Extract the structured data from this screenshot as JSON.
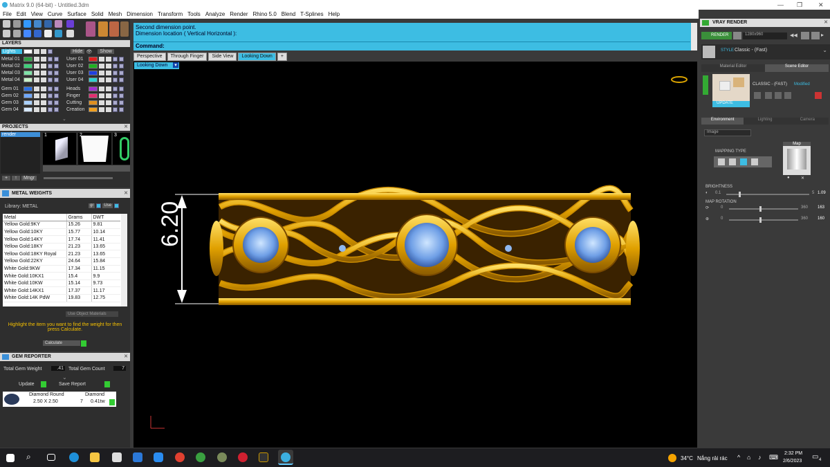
{
  "window": {
    "title": "Matrix 9.0 (64-bit) - Untitled.3dm"
  },
  "menu": [
    "File",
    "Edit",
    "View",
    "Curve",
    "Surface",
    "Solid",
    "Mesh",
    "Dimension",
    "Transform",
    "Tools",
    "Analyze",
    "Render",
    "Rhino 5.0",
    "Blend",
    "T-Splines",
    "Help"
  ],
  "layers": {
    "title": "LAYERS",
    "selected": "Lights",
    "hide": "Hide",
    "show": "Show",
    "left": [
      {
        "name": "Metal 01",
        "color": "#2ea043"
      },
      {
        "name": "Metal 02",
        "color": "#3fd07a"
      },
      {
        "name": "Metal 03",
        "color": "#7fe2a6"
      },
      {
        "name": "Metal 04",
        "color": "#c8f0c8"
      },
      {
        "name": "Gem 01",
        "color": "#2a6fe0"
      },
      {
        "name": "Gem 02",
        "color": "#6fa8ff"
      },
      {
        "name": "Gem 03",
        "color": "#a9d0ff"
      },
      {
        "name": "Gem 04",
        "color": "#d6e8ff"
      }
    ],
    "right": [
      {
        "name": "User 01",
        "color": "#e02020"
      },
      {
        "name": "User 02",
        "color": "#20b020"
      },
      {
        "name": "User 03",
        "color": "#2040e0"
      },
      {
        "name": "User 04",
        "color": "#30d0d0"
      },
      {
        "name": "Heads",
        "color": "#a030d0"
      },
      {
        "name": "Finger",
        "color": "#e03070"
      },
      {
        "name": "Cutting",
        "color": "#e09020"
      },
      {
        "name": "Creation",
        "color": "#f0a020"
      }
    ]
  },
  "projects": {
    "title": "PROJECTS",
    "item": "render",
    "thumbs": [
      "1",
      "2",
      "3"
    ],
    "mngr": "Mngr"
  },
  "metal_weights": {
    "title": "METAL WEIGHTS",
    "library": "Library: METAL",
    "unit1": "gr",
    "unit2": "Use",
    "headers": [
      "Metal",
      "Grams",
      "DWT"
    ],
    "rows": [
      [
        "Yellow Gold:9KY",
        "15.26",
        "9.81"
      ],
      [
        "Yellow Gold:10KY",
        "15.77",
        "10.14"
      ],
      [
        "Yellow Gold:14KY",
        "17.74",
        "11.41"
      ],
      [
        "Yellow Gold:18KY",
        "21.23",
        "13.65"
      ],
      [
        "Yellow Gold:18KY Royal",
        "21.23",
        "13.65"
      ],
      [
        "Yellow Gold:22KY",
        "24.64",
        "15.84"
      ],
      [
        "White Gold:9KW",
        "17.34",
        "11.15"
      ],
      [
        "White Gold:10KX1",
        "15.4",
        "9.9"
      ],
      [
        "White Gold:10KW",
        "15.14",
        "9.73"
      ],
      [
        "White Gold:14KX1",
        "17.37",
        "11.17"
      ],
      [
        "White Gold:14K PdW",
        "19.83",
        "12.75"
      ]
    ],
    "use_obj": "Use Object Materials",
    "hint": "Highlight the item you want to find the weight for then press Calculate.",
    "calc": "Calculate"
  },
  "gem_reporter": {
    "title": "GEM REPORTER",
    "total_weight_label": "Total Gem Weight",
    "total_weight": ".41",
    "total_count_label": "Total Gem Count",
    "total_count": "7",
    "update": "Update",
    "save": "Save Report",
    "gem": {
      "shape": "Diamond Round",
      "size": "2.50 X 2.50",
      "type": "Diamond",
      "count": "7",
      "weight": "0.41tw"
    }
  },
  "command": {
    "line1": "Second dimension point.",
    "line2": "Dimension location ( Vertical  Horizontal ):",
    "prompt": "Command:"
  },
  "view_tabs": [
    "Perspective",
    "Through Finger",
    "Side View",
    "Looking Down"
  ],
  "active_view": "Looking Down",
  "dimension": "6.20",
  "vray": {
    "title": "VRAY RENDER",
    "render": "RENDER",
    "res": "1280x960",
    "style_label": "STYLE",
    "style": "Classic - (Fast)",
    "tab1": "Material Editor",
    "tab2": "Scene Editor",
    "preset": "CLASSIC - (FAST)",
    "modified": "Modified",
    "update": "UPDATE",
    "env_tabs": [
      "Environment",
      "Lighting",
      "Camera"
    ],
    "dropdown": "Image",
    "mapping": "MAPPING TYPE",
    "map": "Map",
    "brightness_label": "BRIGHTNESS",
    "brightness": {
      "min": "0.1",
      "max": "5",
      "value": "1.09"
    },
    "map_rotation_label": "MAP ROTATION",
    "rot1": {
      "min": "0",
      "max": "360",
      "value": "163"
    },
    "rot2": {
      "min": "0",
      "max": "360",
      "value": "160"
    }
  },
  "taskbar": {
    "weather": "34°C",
    "weather_text": "Nắng rải rác",
    "time": "2:32 PM",
    "date": "2/6/2023",
    "notif": "4"
  }
}
